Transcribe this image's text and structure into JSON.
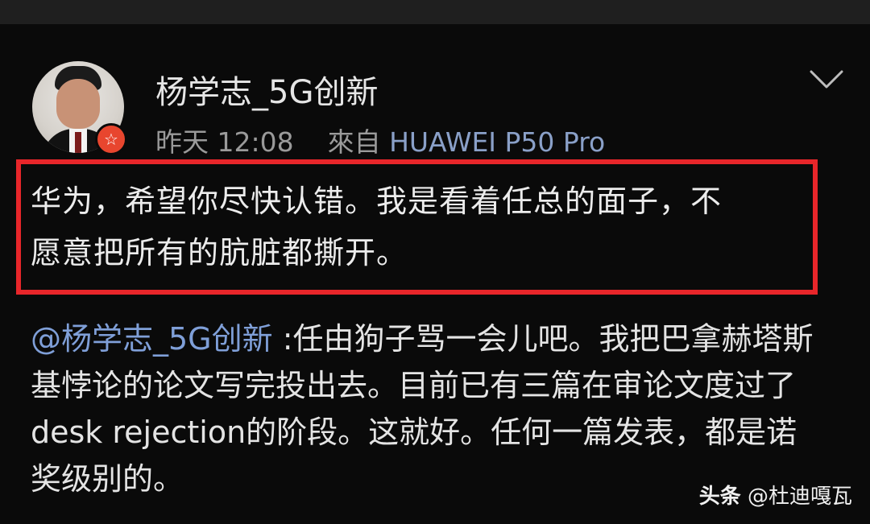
{
  "post": {
    "author": "杨学志_5G创新",
    "time": "昨天 12:08",
    "source_prefix": "來自",
    "source_device": "HUAWEI P50 Pro",
    "text_line1": "华为，希望你尽快认错。我是看着任总的面子，不",
    "text_line2": "愿意把所有的肮脏都撕开。"
  },
  "reply": {
    "mention": "@杨学志_5G创新",
    "text": " :任由狗子骂一会儿吧。我把巴拿赫塔斯基悖论的论文写完投出去。目前已有三篇在审论文度过了desk rejection的阶段。这就好。任何一篇发表，都是诺奖级别的。"
  },
  "watermark": {
    "brand": "头条",
    "handle": "@杜迪嘎瓦"
  },
  "colors": {
    "background": "#0a0a0a",
    "highlight_border": "#e8262a",
    "mention": "#7f9fd8",
    "verify_badge": "#e8462e"
  },
  "icons": {
    "verify_badge": "star-badge-icon",
    "more_menu": "chevron-down-icon"
  }
}
